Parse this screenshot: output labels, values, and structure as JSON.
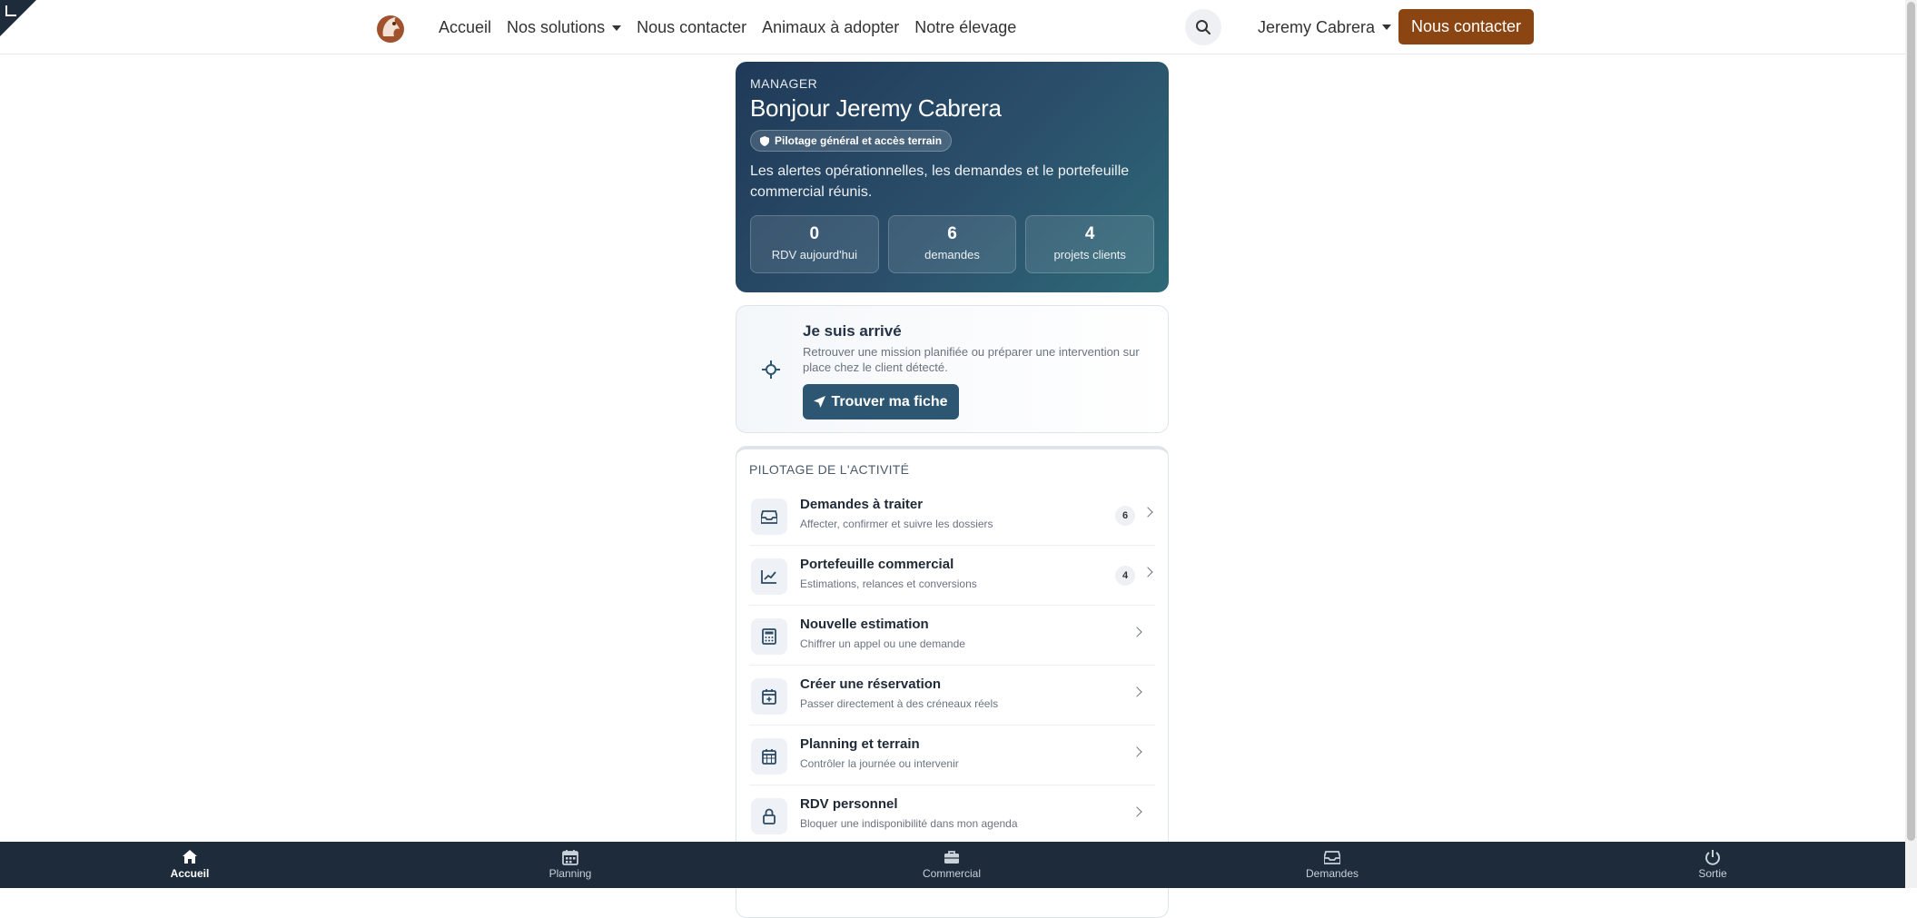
{
  "nav": {
    "links": [
      "Accueil",
      "Nos solutions",
      "Nous contacter",
      "Animaux à adopter",
      "Notre élevage"
    ],
    "user_name": "Jeremy Cabrera",
    "cta_label": "Nous contacter"
  },
  "hero": {
    "role": "MANAGER",
    "title": "Bonjour Jeremy Cabrera",
    "badge": "Pilotage général et accès terrain",
    "description": "Les alertes opérationnelles, les demandes et le portefeuille commercial réunis.",
    "stats": [
      {
        "value": "0",
        "label": "RDV aujourd'hui"
      },
      {
        "value": "6",
        "label": "demandes"
      },
      {
        "value": "4",
        "label": "projets clients"
      }
    ]
  },
  "arrival": {
    "title": "Je suis arrivé",
    "description": "Retrouver une mission planifiée ou préparer une intervention sur place chez le client détecté.",
    "button_label": "Trouver ma fiche"
  },
  "activity": {
    "heading": "PILOTAGE DE L'ACTIVITÉ",
    "items": [
      {
        "title": "Demandes à traiter",
        "subtitle": "Affecter, confirmer et suivre les dossiers",
        "count": "6",
        "icon": "inbox-icon"
      },
      {
        "title": "Portefeuille commercial",
        "subtitle": "Estimations, relances et conversions",
        "count": "4",
        "icon": "chart-line-icon"
      },
      {
        "title": "Nouvelle estimation",
        "subtitle": "Chiffrer un appel ou une demande",
        "icon": "calculator-icon"
      },
      {
        "title": "Créer une réservation",
        "subtitle": "Passer directement à des créneaux réels",
        "icon": "calendar-plus-icon"
      },
      {
        "title": "Planning et terrain",
        "subtitle": "Contrôler la journée ou intervenir",
        "icon": "calendar-icon"
      },
      {
        "title": "RDV personnel",
        "subtitle": "Bloquer une indisponibilité dans mon agenda",
        "icon": "lock-icon"
      }
    ]
  },
  "bottom_nav": [
    {
      "label": "Accueil",
      "icon": "home-icon",
      "active": true
    },
    {
      "label": "Planning",
      "icon": "calendar-icon"
    },
    {
      "label": "Commercial",
      "icon": "briefcase-icon"
    },
    {
      "label": "Demandes",
      "icon": "inbox-icon"
    },
    {
      "label": "Sortie",
      "icon": "power-icon"
    }
  ],
  "colors": {
    "cta": "#8b4513",
    "hero_start": "#1f3a58",
    "hero_end": "#2e6a78",
    "button": "#2d5672",
    "bottom_nav": "#1d2b3a"
  }
}
